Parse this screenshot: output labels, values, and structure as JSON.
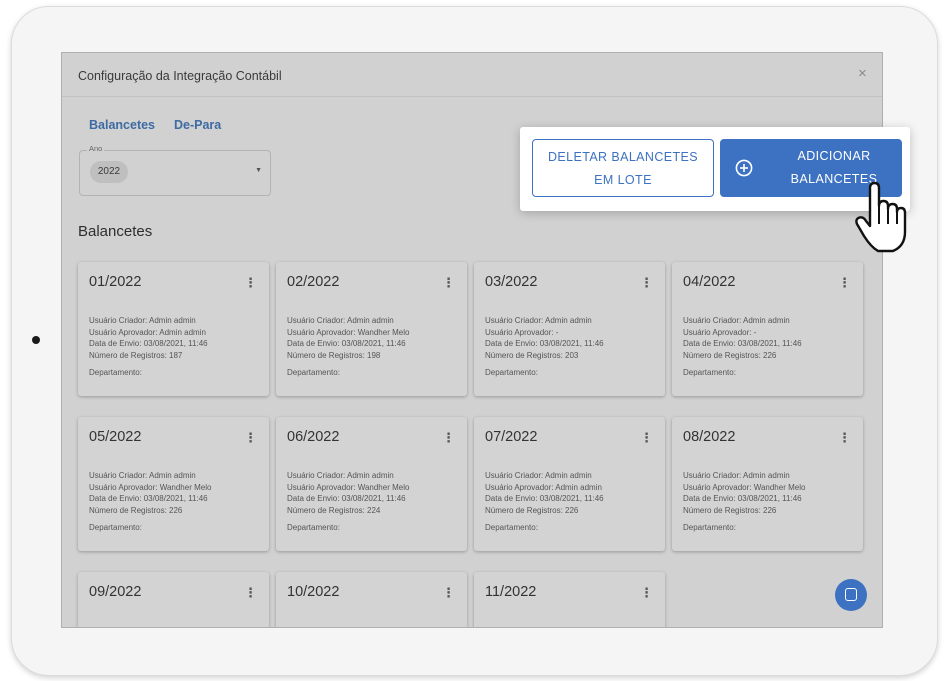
{
  "dialog": {
    "title": "Configuração da Integração Contábil",
    "close_glyph": "×"
  },
  "tabs": [
    {
      "label": "Balancetes"
    },
    {
      "label": "De-Para"
    }
  ],
  "year_select": {
    "label": "Ano",
    "value": "2022"
  },
  "section_title": "Balancetes",
  "cards": [
    {
      "period": "01/2022",
      "criador": "Usuário Criador: Admin admin",
      "aprovador": "Usuário Aprovador: Admin admin",
      "envio": "Data de Envio: 03/08/2021, 11:46",
      "registros": "Número de Registros: 187",
      "departamento": "Departamento:"
    },
    {
      "period": "02/2022",
      "criador": "Usuário Criador: Admin admin",
      "aprovador": "Usuário Aprovador: Wandher Melo",
      "envio": "Data de Envio: 03/08/2021, 11:46",
      "registros": "Número de Registros: 198",
      "departamento": "Departamento:"
    },
    {
      "period": "03/2022",
      "criador": "Usuário Criador: Admin admin",
      "aprovador": "Usuário Aprovador: -",
      "envio": "Data de Envio: 03/08/2021, 11:46",
      "registros": "Número de Registros: 203",
      "departamento": "Departamento:"
    },
    {
      "period": "04/2022",
      "criador": "Usuário Criador: Admin admin",
      "aprovador": "Usuário Aprovador: -",
      "envio": "Data de Envio: 03/08/2021, 11:46",
      "registros": "Número de Registros: 226",
      "departamento": "Departamento:"
    },
    {
      "period": "05/2022",
      "criador": "Usuário Criador: Admin admin",
      "aprovador": "Usuário Aprovador: Wandher Melo",
      "envio": "Data de Envio: 03/08/2021, 11:46",
      "registros": "Número de Registros: 226",
      "departamento": "Departamento:"
    },
    {
      "period": "06/2022",
      "criador": "Usuário Criador: Admin admin",
      "aprovador": "Usuário Aprovador: Wandher Melo",
      "envio": "Data de Envio: 03/08/2021, 11:46",
      "registros": "Número de Registros: 224",
      "departamento": "Departamento:"
    },
    {
      "period": "07/2022",
      "criador": "Usuário Criador: Admin admin",
      "aprovador": "Usuário Aprovador: Admin admin",
      "envio": "Data de Envio: 03/08/2021, 11:46",
      "registros": "Número de Registros: 226",
      "departamento": "Departamento:"
    },
    {
      "period": "08/2022",
      "criador": "Usuário Criador: Admin admin",
      "aprovador": "Usuário Aprovador: Wandher Melo",
      "envio": "Data de Envio: 03/08/2021, 11:46",
      "registros": "Número de Registros: 226",
      "departamento": "Departamento:"
    },
    {
      "period": "09/2022"
    },
    {
      "period": "10/2022"
    },
    {
      "period": "11/2022"
    }
  ],
  "card_menu_glyph": "⋮",
  "actions": {
    "delete_line1": "DELETAR BALANCETES",
    "delete_line2": "EM LOTE",
    "add_line1": "ADICIONAR",
    "add_line2": "BALANCETES"
  },
  "colors": {
    "primary": "#3d72c2",
    "tab_text": "#3d6ba3",
    "overlay": "#d1d1d1"
  },
  "icons": [
    "close-icon",
    "chevron-down-icon",
    "more-vert-icon",
    "plus-circle-icon",
    "chat-icon",
    "hand-pointer-icon"
  ]
}
